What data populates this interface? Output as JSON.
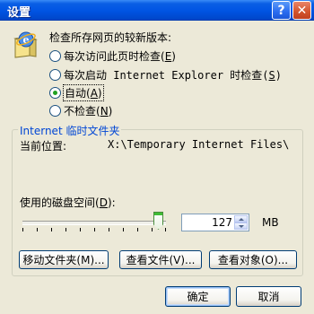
{
  "window": {
    "title": "设置",
    "help_glyph": "?",
    "close_glyph": "✕"
  },
  "check_versions": {
    "heading": "检查所存网页的较新版本:",
    "options": [
      {
        "label": "每次访问此页时检查(",
        "key": "E",
        "suffix": ")",
        "checked": false
      },
      {
        "label": "每次启动 Internet Explorer 时检查(",
        "key": "S",
        "suffix": ")",
        "checked": false
      },
      {
        "label": "自动(",
        "key": "A",
        "suffix": ")",
        "checked": true
      },
      {
        "label": "不检查(",
        "key": "N",
        "suffix": ")",
        "checked": false
      }
    ]
  },
  "temp_files": {
    "group_title": "Internet 临时文件夹",
    "location_label": "当前位置:",
    "location_value": "X:\\Temporary Internet Files\\",
    "disk_space_label": "使用的磁盘空间(",
    "disk_space_key": "D",
    "disk_space_suffix": "):",
    "disk_space_value": "127",
    "disk_space_unit": "MB",
    "slider_level": 0.93
  },
  "buttons": {
    "move_folder": "移动文件夹(M)...",
    "view_files": "查看文件(V)...",
    "view_objects": "查看对象(O)...",
    "ok": "确定",
    "cancel": "取消"
  },
  "colors": {
    "titlebar": "#0054e3",
    "dialog_bg": "#ece9d8",
    "group_title": "#0046d5",
    "radio_dot": "#21a121"
  },
  "icons": [
    "ie-settings-icon",
    "help-icon",
    "close-icon"
  ]
}
